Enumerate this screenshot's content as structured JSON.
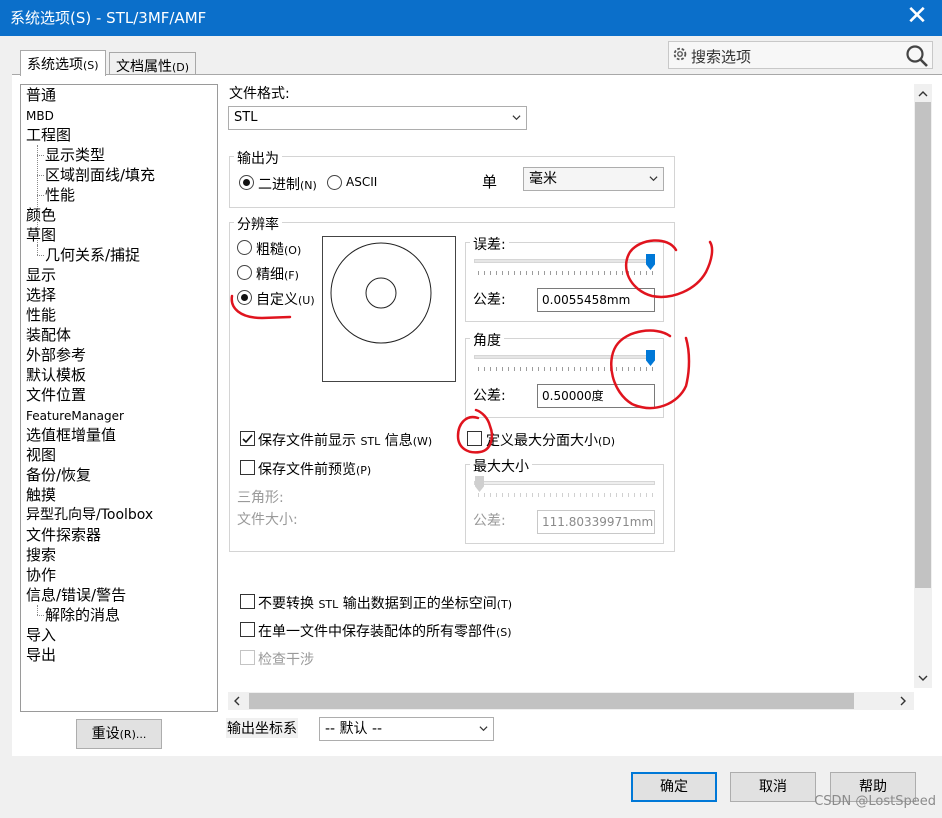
{
  "window": {
    "title": "系统选项(S) - STL/3MF/AMF",
    "close_glyph": "✕"
  },
  "tabs": [
    {
      "label": "系统选项",
      "shortcut": "(S)",
      "active": true
    },
    {
      "label": "文档属性",
      "shortcut": "(D)",
      "active": false
    }
  ],
  "search": {
    "placeholder": "搜索选项"
  },
  "tree": {
    "items": [
      {
        "label": "普通"
      },
      {
        "label": "MBD"
      },
      {
        "label": "工程图"
      },
      {
        "label": "显示类型"
      },
      {
        "label": "区域剖面线/填充"
      },
      {
        "label": "性能"
      },
      {
        "label": "颜色"
      },
      {
        "label": "草图"
      },
      {
        "label": "几何关系/捕捉"
      },
      {
        "label": "显示"
      },
      {
        "label": "选择"
      },
      {
        "label": "性能"
      },
      {
        "label": "装配体"
      },
      {
        "label": "外部参考"
      },
      {
        "label": "默认模板"
      },
      {
        "label": "文件位置"
      },
      {
        "label": "FeatureManager"
      },
      {
        "label": "选值框增量值"
      },
      {
        "label": "视图"
      },
      {
        "label": "备份/恢复"
      },
      {
        "label": "触摸"
      },
      {
        "label": "异型孔向导/Toolbox"
      },
      {
        "label": "文件探索器"
      },
      {
        "label": "搜索"
      },
      {
        "label": "协作"
      },
      {
        "label": "信息/错误/警告"
      },
      {
        "label": "解除的消息"
      },
      {
        "label": "导入"
      },
      {
        "label": "导出"
      }
    ]
  },
  "reset_button": {
    "label": "重设",
    "shortcut": "(R)..."
  },
  "file_format": {
    "label": "文件格式:",
    "value": "STL"
  },
  "output_as": {
    "group_label": "输出为",
    "binary": {
      "label": "二进制",
      "shortcut": "(N)",
      "selected": true
    },
    "ascii": {
      "label": "ASCII",
      "selected": false
    },
    "unit_label": "单",
    "unit_value": "毫米"
  },
  "resolution": {
    "group_label": "分辨率",
    "coarse": {
      "label": "粗糙",
      "shortcut": "(O)",
      "selected": false
    },
    "fine": {
      "label": "精细",
      "shortcut": "(F)",
      "selected": false
    },
    "custom": {
      "label": "自定义",
      "shortcut": "(U)",
      "selected": true
    },
    "deviation": {
      "label": "误差:",
      "tolerance_label": "公差:",
      "tolerance_value": "0.0055458mm",
      "slider_level": 0.98
    },
    "angle": {
      "label": "角度",
      "tolerance_label": "公差:",
      "tolerance_value": "0.50000度",
      "slider_level": 0.98
    },
    "show_stl_info": {
      "label": "保存文件前显示",
      "stl": "STL",
      "label2": "信息",
      "shortcut": "(W)",
      "checked": true
    },
    "preview": {
      "label": "保存文件前预览",
      "shortcut": "(P)",
      "checked": false
    },
    "triangles_label": "三角形:",
    "file_size_label": "文件大小:",
    "define_max_facet": {
      "label": "定义最大分面大小",
      "shortcut": "(D)",
      "checked": false
    },
    "max_size": {
      "label": "最大大小",
      "tolerance_label": "公差:",
      "tolerance_value": "111.80339971mm",
      "slider_level": 0.0
    }
  },
  "options": {
    "no_convert": {
      "label_a": "不要转换",
      "stl": "STL",
      "label_b": "输出数据到正的坐标空间",
      "shortcut": "(T)",
      "checked": false
    },
    "single_file": {
      "label": "在单一文件中保存装配体的所有零部件",
      "shortcut": "(S)",
      "checked": false
    },
    "check_interference": {
      "label": "检查干涉",
      "checked": false,
      "disabled": true
    }
  },
  "output_coord": {
    "label": "输出坐标系",
    "value": "-- 默认 --"
  },
  "buttons": {
    "ok": "确定",
    "cancel": "取消",
    "help": "帮助"
  },
  "watermark": "CSDN @LostSpeed",
  "colors": {
    "accent": "#0b6fca",
    "slider_thumb": "#0078d7",
    "annotation": "#e0141e"
  }
}
